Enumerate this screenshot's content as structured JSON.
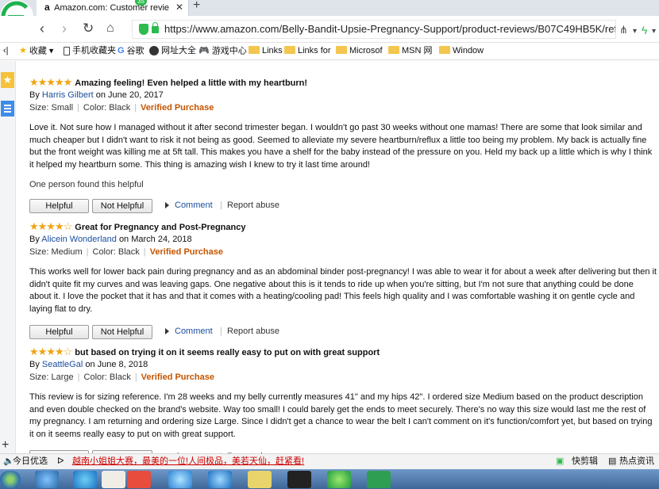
{
  "browser": {
    "tab_title": "Amazon.com: Customer revie",
    "tab_badge": "35",
    "url": "https://www.amazon.com/Belly-Bandit-Upsie-Pregnancy-Support/product-reviews/B07C49HB5K/ref=c",
    "bookmarks": [
      "收藏",
      "手机收藏夹",
      "谷歌",
      "网址大全",
      "游戏中心",
      "Links",
      "Links for",
      "Microsof",
      "MSN 网",
      "Window"
    ]
  },
  "reviews": [
    {
      "stars": "★★★★★",
      "title": "Amazing feeling! Even helped a little with my heartburn!",
      "by": "By",
      "author": "Harris Gilbert",
      "date": "on June 20, 2017",
      "size": "Size: Small",
      "color": "Color: Black",
      "verified": "Verified Purchase",
      "body": "Love it. Not sure how I managed without it after second trimester began. I wouldn't go past 30 weeks without one mamas! There are some that look similar and much cheaper but I didn't want to risk it not being as good. Seemed to alleviate my severe heartburn/reflux a little too being my problem. My back is actually fine but the front weight was killing me at 5ft tall. This makes you have a shelf for the baby instead of the pressure on you. Held my back up a little which is why I think it helped my heartburn some. This thing is amazing wish I knew to try it last time around!",
      "helpful_count": "One person found this helpful"
    },
    {
      "stars": "★★★★☆",
      "title": "Great for Pregnancy and Post-Pregnancy",
      "by": "By",
      "author": "Alicein Wonderland",
      "date": "on March 24, 2018",
      "size": "Size: Medium",
      "color": "Color: Black",
      "verified": "Verified Purchase",
      "body": "This works well for lower back pain during pregnancy and as an abdominal binder post-pregnancy! I was able to wear it for about a week after delivering but then it didn't quite fit my curves and was leaving gaps. One negative about this is it tends to ride up when you're sitting, but I'm not sure that anything could be done about it. I love the pocket that it has and that it comes with a heating/cooling pad! This feels high quality and I was comfortable washing it on gentle cycle and laying flat to dry."
    },
    {
      "stars": "★★★★☆",
      "title": "but based on trying it on it seems really easy to put on with great support",
      "by": "By",
      "author": "SeattleGal",
      "date": "on June 8, 2018",
      "size": "Size: Large",
      "color": "Color: Black",
      "verified": "Verified Purchase",
      "body": "This review is for sizing reference. I'm 28 weeks and my belly currently measures 41\" and my hips 42\". I ordered size Medium based on the product description and even double checked on the brand's website. Way too small! I could barely get the ends to meet securely. There's no way this size would last me the rest of my pregnancy. I am returning and ordering size Large. Since I didn't get a chance to wear the belt I can't comment on it's function/comfort yet, but based on trying it on it seems really easy to put on with great support."
    }
  ],
  "actions": {
    "helpful": "Helpful",
    "not_helpful": "Not Helpful",
    "comment": "Comment",
    "report": "Report abuse"
  },
  "status": {
    "left": "今日优选",
    "news": "越南小姐姐大赛，最美的一位!人间极品，美若天仙，赶紧看!",
    "right1": "快剪辑",
    "right2": "热点资讯"
  },
  "colors": {
    "star": "#f0a312",
    "link": "#1a4d9e",
    "verified": "#c45500",
    "secure": "#2dba4e"
  }
}
